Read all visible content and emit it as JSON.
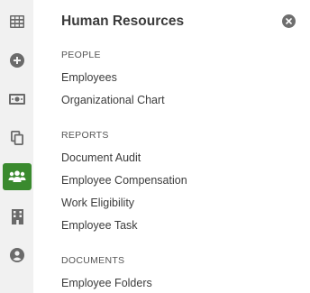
{
  "rail": {
    "items": [
      {
        "icon": "grid-icon"
      },
      {
        "icon": "add-circle-icon"
      },
      {
        "icon": "money-icon"
      },
      {
        "icon": "copy-icon"
      },
      {
        "icon": "people-icon",
        "active": true
      },
      {
        "icon": "building-icon"
      },
      {
        "icon": "user-circle-icon"
      }
    ],
    "active_color": "#3a8a2e"
  },
  "panel": {
    "title": "Human Resources",
    "close_icon": "close-icon",
    "sections": [
      {
        "heading": "PEOPLE",
        "links": [
          "Employees",
          "Organizational Chart"
        ]
      },
      {
        "heading": "REPORTS",
        "links": [
          "Document Audit",
          "Employee Compensation",
          "Work Eligibility",
          "Employee Task"
        ]
      },
      {
        "heading": "DOCUMENTS",
        "links": [
          "Employee Folders"
        ]
      }
    ]
  }
}
